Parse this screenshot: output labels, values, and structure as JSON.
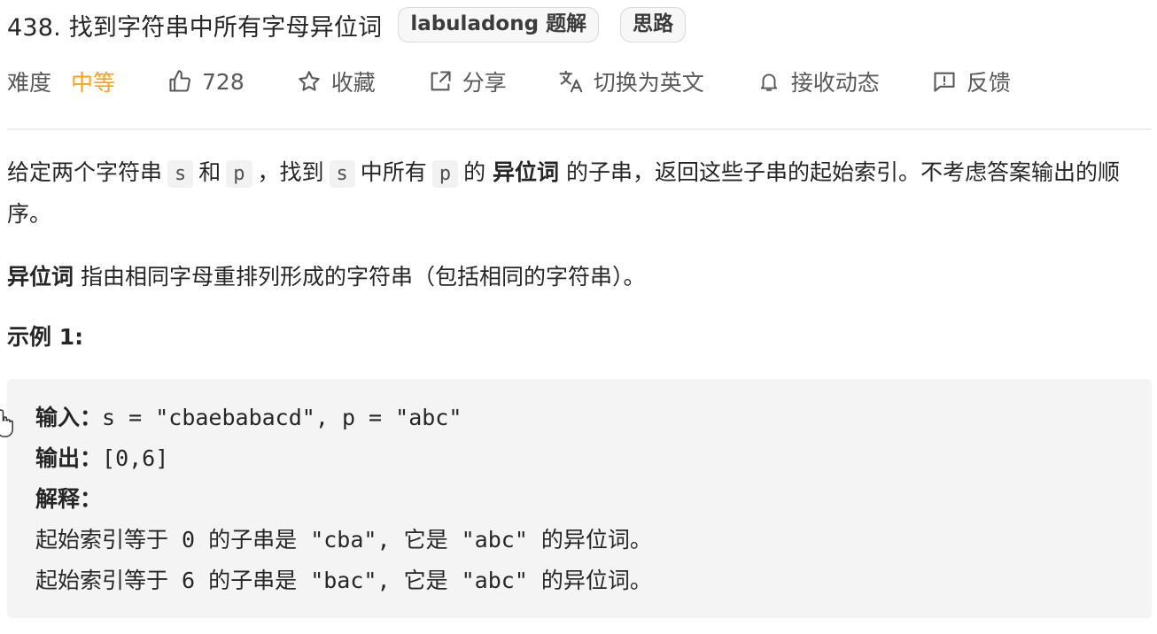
{
  "problem": {
    "title": "438. 找到字符串中所有字母异位词",
    "tags": [
      "labuladong 题解",
      "思路"
    ]
  },
  "meta": {
    "difficulty_label": "难度",
    "difficulty_value": "中等",
    "likes": "728",
    "favorite": "收藏",
    "share": "分享",
    "switch_language": "切换为英文",
    "subscribe": "接收动态",
    "feedback": "反馈"
  },
  "description": {
    "p1_a": "给定两个字符串",
    "code_s": "s",
    "p1_b": "和",
    "code_p": "p",
    "p1_c": "，找到",
    "p1_d": "中所有",
    "p1_e": "的",
    "bold_term": "异位词",
    "p1_f": "的子串，返回这些子串的起始索引。不考虑答案输出的顺序。",
    "def_term": "异位词",
    "def_text": "指由相同字母重排列形成的字符串（包括相同的字符串）。",
    "example_title": "示例 1:"
  },
  "example": {
    "input_label": "输入：",
    "input_value": "s = \"cbaebabacd\", p = \"abc\"",
    "output_label": "输出：",
    "output_value": "[0,6]",
    "explain_label": "解释：",
    "explain_1": "起始索引等于 0 的子串是 \"cba\", 它是 \"abc\" 的异位词。",
    "explain_2": "起始索引等于 6 的子串是 \"bac\", 它是 \"abc\" 的异位词。"
  },
  "colors": {
    "difficulty_medium": "#ffa116",
    "text": "#262626",
    "muted": "#595959",
    "code_bg": "#f4f4f4"
  },
  "icons": [
    "thumbs-up-icon",
    "star-icon",
    "share-icon",
    "translate-icon",
    "bell-icon",
    "feedback-icon",
    "hand-cursor-icon"
  ]
}
